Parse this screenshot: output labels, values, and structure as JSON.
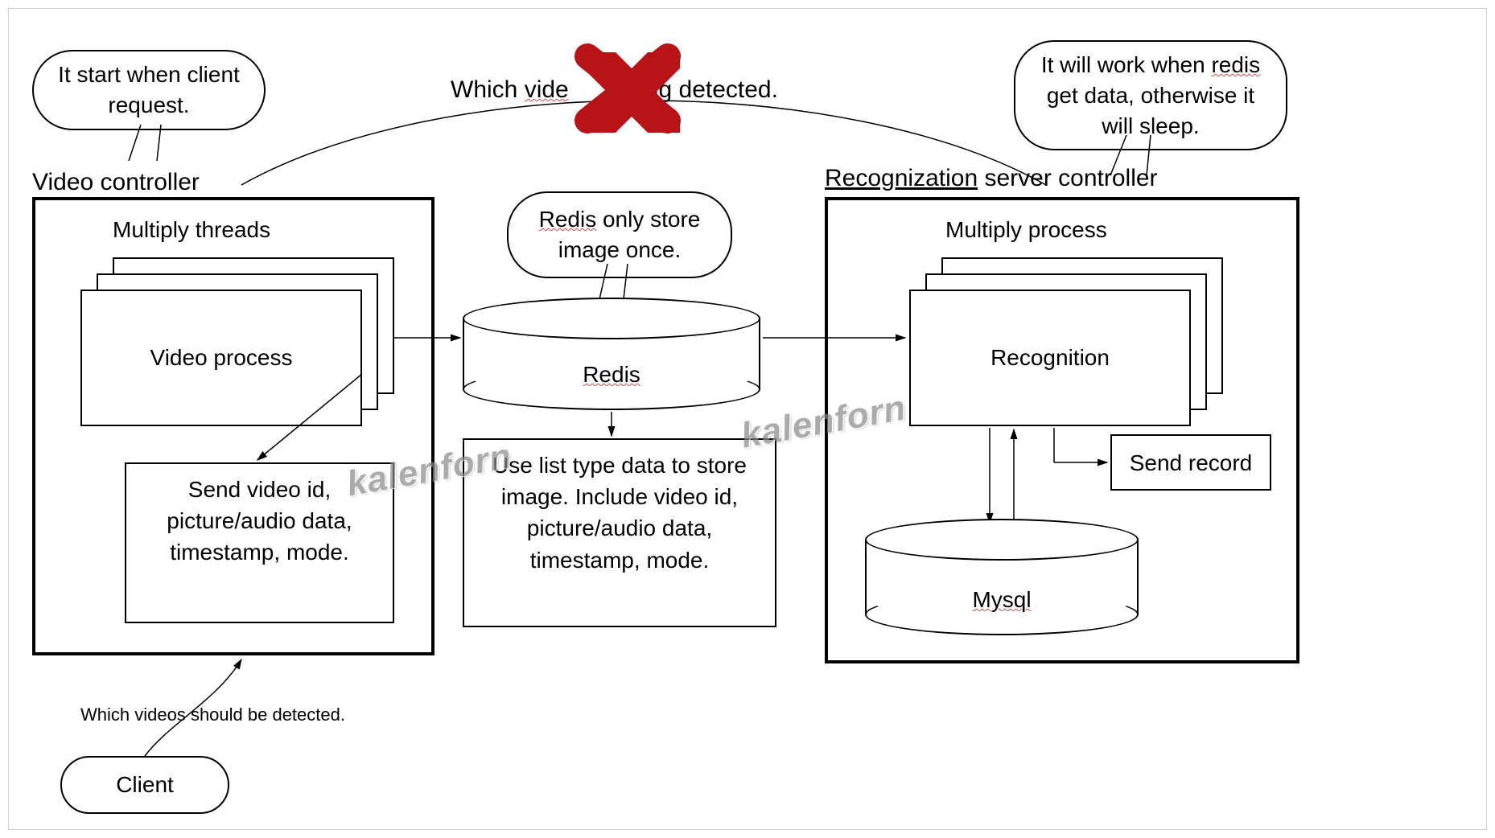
{
  "top_caption_prefix": "Which ",
  "top_caption_mid": "vide",
  "top_caption_suffix_1": "eing",
  "top_caption_suffix_2": " detected.",
  "speech_left": "It start when client request.",
  "speech_right_prefix": "It will work when ",
  "speech_right_redis": "redis",
  "speech_right_suffix": " get data, otherwise it will sleep.",
  "redis_speech_prefix": "",
  "redis_speech_redis": "Redis",
  "redis_speech_suffix": " only store image once.",
  "video_controller_title": "Video controller",
  "recog_controller_title_prefix": "",
  "recog_controller_title_word": "Recognization",
  "recog_controller_title_suffix": " server controller",
  "multiply_threads": "Multiply threads",
  "multiply_process": "Multiply process",
  "video_process": "Video process",
  "recognition": "Recognition",
  "send_record": "Send record",
  "redis_label": "Redis",
  "mysql_label": "Mysql",
  "note_left": "Send video id, picture/audio data, timestamp, mode.",
  "note_center": "Use list type data to store image. Include video id, picture/audio data, timestamp, mode.",
  "client_note": "Which videos should be detected.",
  "client_label": "Client",
  "watermark": "kalenforn",
  "mysql_word": "Mysql"
}
